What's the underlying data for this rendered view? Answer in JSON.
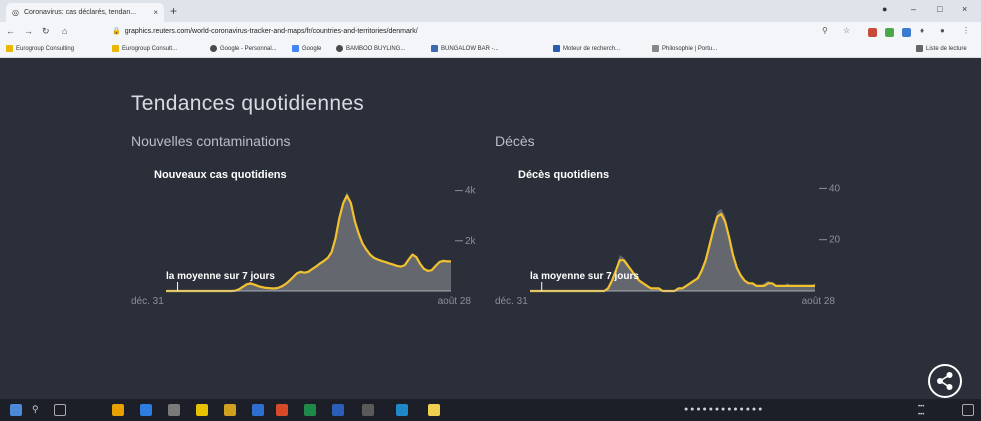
{
  "browser": {
    "tab_title": "Coronavirus: cas déclarés, tendan...",
    "tab_close": "×",
    "new_tab": "+",
    "url": "graphics.reuters.com/world-coronavirus-tracker-and-maps/fr/countries-and-territories/denmark/",
    "bookmarks": [
      "Eurogroup Consulting",
      "Eurogroup Consult...",
      "Google - Personnal...",
      "Google",
      "BAMBOO BUYLING...",
      "BUNGALOW BAR -...",
      "Moteur de recherch...",
      "Philosophie | Portu...",
      "Liste de lecture"
    ]
  },
  "page": {
    "title": "Tendances quotidiennes",
    "left": {
      "heading": "Nouvelles contaminations",
      "chart_data": {
        "type": "area",
        "title": "Nouveaux cas quotidiens",
        "annotation": "la moyenne sur 7 jours",
        "x_start_label": "déc. 31",
        "x_end_label": "août 28",
        "y_ticks": [
          "4k",
          "2k"
        ],
        "ylim": [
          0,
          4700
        ],
        "series": [
          {
            "name": "Nouveaux cas quotidiens",
            "values": [
              0,
              0,
              0,
              0,
              0,
              0,
              0,
              0,
              0,
              0,
              0,
              0,
              0,
              0,
              0,
              0,
              0,
              0,
              0,
              20,
              150,
              300,
              380,
              260,
              180,
              140,
              120,
              110,
              90,
              120,
              200,
              300,
              450,
              600,
              760,
              820,
              700,
              780,
              900,
              1000,
              1150,
              1250,
              1350,
              1600,
              2200,
              3000,
              3600,
              3950,
              3500,
              2800,
              2300,
              1900,
              1600,
              1400,
              1300,
              1250,
              1200,
              1150,
              1100,
              1050,
              1000,
              950,
              1050,
              1300,
              1500,
              1350,
              1050,
              850,
              780,
              820,
              1050,
              1200,
              1250,
              1200,
              1200
            ]
          },
          {
            "name": "la moyenne sur 7 jours",
            "values": [
              0,
              0,
              0,
              0,
              0,
              0,
              0,
              0,
              0,
              0,
              0,
              0,
              0,
              0,
              0,
              0,
              0,
              0,
              10,
              70,
              170,
              270,
              300,
              250,
              190,
              150,
              125,
              110,
              100,
              120,
              180,
              270,
              400,
              550,
              700,
              760,
              730,
              770,
              880,
              980,
              1100,
              1200,
              1320,
              1550,
              2100,
              2900,
              3500,
              3800,
              3500,
              2800,
              2300,
              1900,
              1650,
              1450,
              1320,
              1250,
              1200,
              1150,
              1100,
              1050,
              1000,
              970,
              1030,
              1250,
              1450,
              1350,
              1080,
              880,
              800,
              830,
              1000,
              1150,
              1200,
              1180,
              1180
            ]
          }
        ]
      }
    },
    "right": {
      "heading": "Décès",
      "chart_data": {
        "type": "area",
        "title": "Décès quotidiens",
        "annotation": "la moyenne sur 7 jours",
        "x_start_label": "déc. 31",
        "x_end_label": "août 28",
        "y_ticks": [
          "40",
          "20"
        ],
        "ylim": [
          0,
          46
        ],
        "series": [
          {
            "name": "Décès quotidiens",
            "values": [
              0,
              0,
              0,
              0,
              0,
              0,
              0,
              0,
              0,
              0,
              0,
              0,
              0,
              0,
              0,
              0,
              0,
              0,
              0,
              0,
              2,
              5,
              9,
              14,
              13,
              11,
              8,
              6,
              4,
              3,
              2,
              1,
              1,
              1,
              0,
              0,
              0,
              0,
              1,
              1,
              2,
              3,
              4,
              6,
              9,
              13,
              19,
              26,
              31,
              32,
              29,
              22,
              15,
              9,
              6,
              4,
              3,
              3,
              2,
              2,
              3,
              4,
              3,
              2,
              2,
              2,
              3,
              2,
              2,
              2,
              2,
              2,
              2,
              3
            ]
          },
          {
            "name": "la moyenne sur 7 jours",
            "values": [
              0,
              0,
              0,
              0,
              0,
              0,
              0,
              0,
              0,
              0,
              0,
              0,
              0,
              0,
              0,
              0,
              0,
              0,
              0,
              0,
              1,
              4,
              8,
              12,
              12,
              10,
              8,
              6,
              4,
              3,
              2,
              1,
              1,
              1,
              0,
              0,
              0,
              0,
              1,
              1,
              2,
              3,
              4,
              5,
              8,
              12,
              18,
              24,
              29,
              30,
              27,
              21,
              14,
              9,
              6,
              4,
              3,
              3,
              2,
              2,
              2,
              3,
              3,
              2,
              2,
              2,
              2,
              2,
              2,
              2,
              2,
              2,
              2,
              2
            ]
          }
        ]
      }
    }
  },
  "colors": {
    "background": "#2b2f3a",
    "area_fill": "#6f7178",
    "average_line": "#f2c12e",
    "text": "#ffffff",
    "axis_text": "#8a8f99"
  }
}
